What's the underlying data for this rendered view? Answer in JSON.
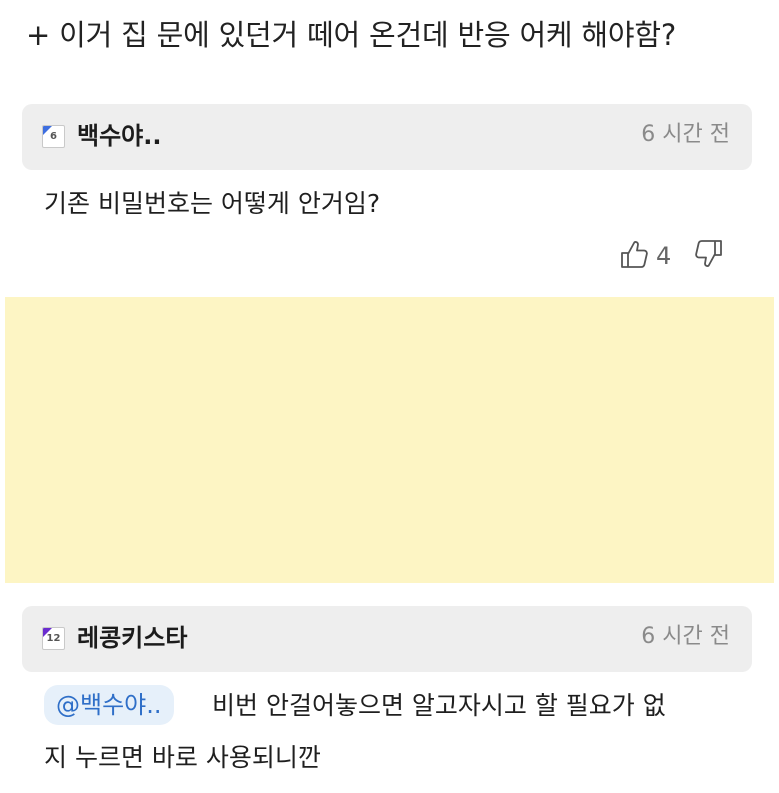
{
  "post": {
    "title": "+ 이거 집 문에 있던거 떼어 온건데 반응 어케 해야함?"
  },
  "comments": [
    {
      "level": "6",
      "username": "백수야..",
      "time": "6 시간 전",
      "body": "기존 비밀번호는 어떻게 안거임?",
      "likes": "4"
    },
    {
      "level": "12",
      "username": "레콩키스타",
      "time": "6 시간 전",
      "mention": "@백수야..",
      "body_line1": "비번 안걸어놓으면 알고자시고 할 필요가 없",
      "body_line2": "지 누르면 바로 사용되니깐"
    }
  ],
  "colors": {
    "header_bg": "#eeeeee",
    "ad_bg": "#fdf5c4",
    "mention_bg": "#e6f0fa",
    "mention_text": "#2f6fc8",
    "level6_accent": "#3d6ee0",
    "level12_accent": "#6a2ccf"
  },
  "icons": {
    "like": "thumbs-up-icon",
    "dislike": "thumbs-down-icon"
  }
}
